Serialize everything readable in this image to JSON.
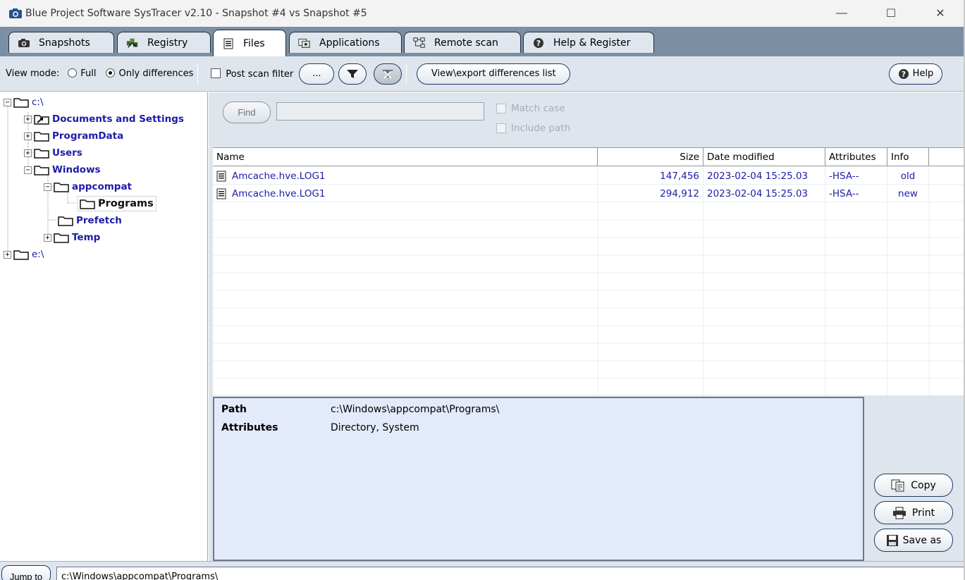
{
  "window": {
    "title": "Blue Project Software SysTracer v2.10 - Snapshot #4 vs Snapshot #5",
    "minimize": "—",
    "maximize": "☐",
    "close": "✕"
  },
  "tabs": [
    {
      "label": "Snapshots",
      "icon": "camera-icon"
    },
    {
      "label": "Registry",
      "icon": "registry-icon"
    },
    {
      "label": "Files",
      "icon": "file-icon",
      "active": true
    },
    {
      "label": "Applications",
      "icon": "applications-icon"
    },
    {
      "label": "Remote scan",
      "icon": "network-icon"
    },
    {
      "label": "Help & Register",
      "icon": "help-icon"
    }
  ],
  "toolbar": {
    "view_mode_label": "View mode:",
    "full_label": "Full",
    "only_diff_label": "Only differences",
    "post_scan_label": "Post scan filter",
    "ellipsis_label": "...",
    "view_export_label": "View\\export differences list",
    "help_label": "Help"
  },
  "tree": {
    "c_drive": "c:\\",
    "documents": "Documents and Settings",
    "programdata": "ProgramData",
    "users": "Users",
    "windows": "Windows",
    "appcompat": "appcompat",
    "programs": "Programs",
    "prefetch": "Prefetch",
    "temp": "Temp",
    "e_drive": "e:\\"
  },
  "find": {
    "button": "Find",
    "value": "",
    "match_case": "Match case",
    "include_path": "Include path"
  },
  "table": {
    "columns": [
      "Name",
      "Size",
      "Date modified",
      "Attributes",
      "Info"
    ],
    "rows": [
      {
        "name": "Amcache.hve.LOG1",
        "size": "147,456",
        "date": "2023-02-04 15:25.03",
        "attributes": "-HSA--",
        "info": "old"
      },
      {
        "name": "Amcache.hve.LOG1",
        "size": "294,912",
        "date": "2023-02-04 15:25.03",
        "attributes": "-HSA--",
        "info": "new"
      }
    ]
  },
  "details": {
    "path_label": "Path",
    "path_value": "c:\\Windows\\appcompat\\Programs\\",
    "attributes_label": "Attributes",
    "attributes_value": "Directory, System"
  },
  "actions": {
    "copy": "Copy",
    "print": "Print",
    "save_as": "Save as"
  },
  "bottom": {
    "jump_label": "Jump to",
    "jump_value": "c:\\Windows\\appcompat\\Programs\\"
  }
}
